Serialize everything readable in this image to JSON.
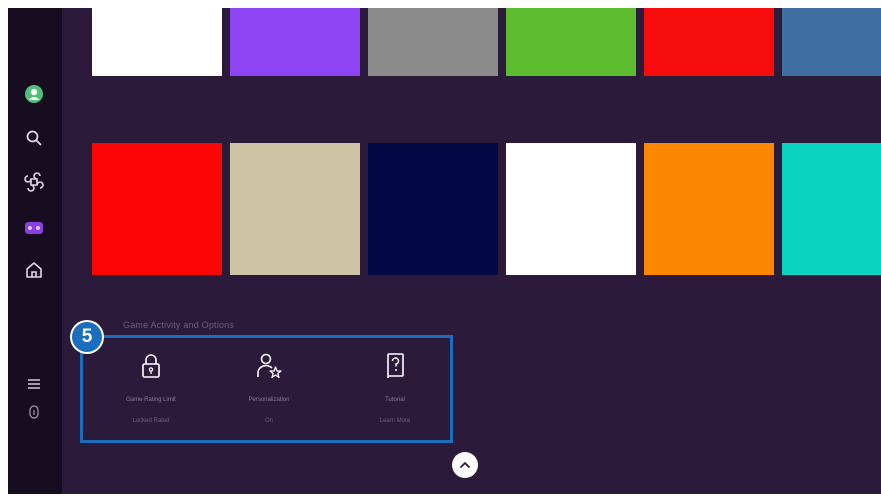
{
  "sidebar": {
    "items": [
      {
        "name": "profile",
        "icon": "profile-icon"
      },
      {
        "name": "search",
        "icon": "search-icon"
      },
      {
        "name": "ambient",
        "icon": "ambient-icon"
      },
      {
        "name": "gaming-hub",
        "icon": "gamepad-icon"
      },
      {
        "name": "home",
        "icon": "home-icon"
      },
      {
        "name": "menu",
        "icon": "menu-icon"
      },
      {
        "name": "info",
        "icon": "info-icon"
      }
    ],
    "accent": "#8b3fe0"
  },
  "tile_rows": [
    [
      "#ffffff",
      "#8d45f3",
      "#8b8b8b",
      "#5dbb2f",
      "#f50c0b",
      "#3e6fa0"
    ],
    [
      "#fb0505",
      "#cdc3a4",
      "#010844",
      "#ffffff",
      "#fd8800",
      "#0bd3c1"
    ]
  ],
  "callout": {
    "number": "5"
  },
  "section": {
    "title": "Game Activity and Options",
    "options": [
      {
        "icon": "lock-icon",
        "label": "Game Rating Limit",
        "value": "Locked Rated"
      },
      {
        "icon": "user-star-icon",
        "label": "Personalization",
        "value": "On"
      },
      {
        "icon": "help-book-icon",
        "label": "Tutorial",
        "value": "Learn More"
      }
    ]
  },
  "highlight_color": "#1b6dbd",
  "scroll_button": {
    "icon": "chevron-up-icon"
  }
}
